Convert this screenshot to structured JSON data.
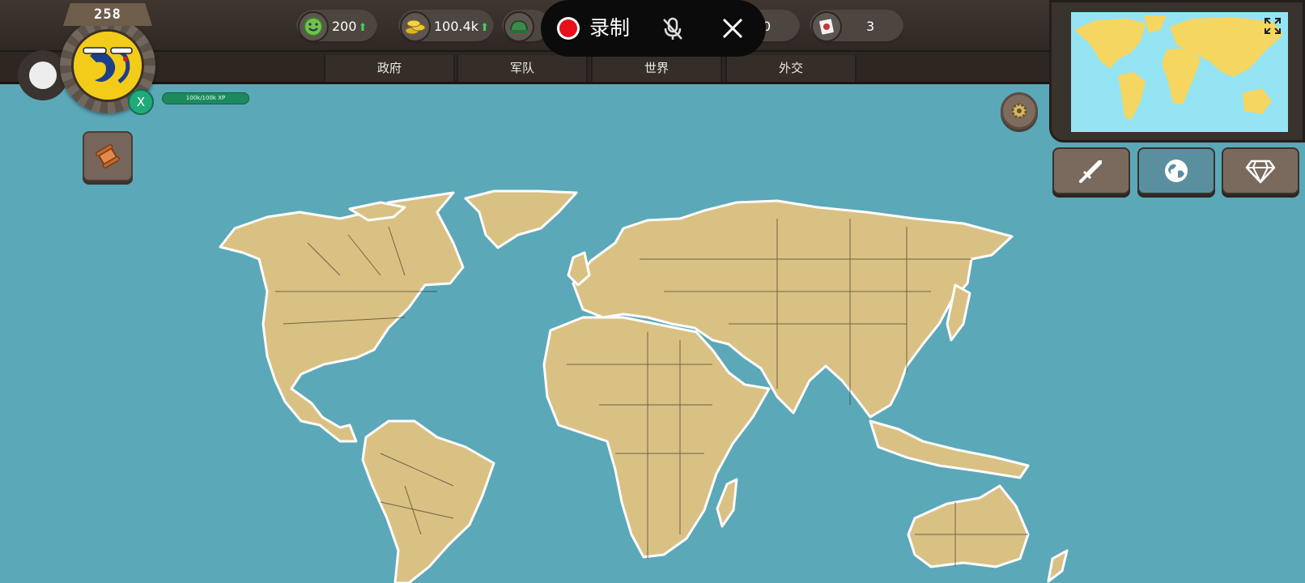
{
  "player": {
    "level": "258",
    "xp_text": "100k/100k XP",
    "badge": "X"
  },
  "resources": [
    {
      "name": "happiness",
      "icon": "smiley-icon",
      "value": "200",
      "trend": "up"
    },
    {
      "name": "money",
      "icon": "coins-icon",
      "value": "100.4k",
      "trend": "up"
    },
    {
      "name": "army",
      "icon": "helmet-icon",
      "value": "",
      "trend": ""
    },
    {
      "name": "unknown",
      "icon": "dark-coin-icon",
      "value": "0",
      "trend": ""
    },
    {
      "name": "cards",
      "icon": "card-icon",
      "value": "3",
      "trend": ""
    }
  ],
  "tabs": [
    "政府",
    "军队",
    "世界",
    "外交"
  ],
  "recording": {
    "label": "录制",
    "icons": [
      "record-dot-icon",
      "mic-muted-icon",
      "close-icon"
    ]
  },
  "right_buttons": [
    {
      "icon": "sword-icon",
      "active": false
    },
    {
      "icon": "globe-icon",
      "active": true
    },
    {
      "icon": "diamond-icon",
      "active": false
    }
  ],
  "colors": {
    "ocean": "#5ba8b8",
    "land": "#d9c184",
    "panel": "#2f2823",
    "minimap_ocean": "#95e4f4",
    "minimap_land": "#f5d660",
    "record_red": "#e8101a",
    "xp_green": "#1c8a5c"
  }
}
